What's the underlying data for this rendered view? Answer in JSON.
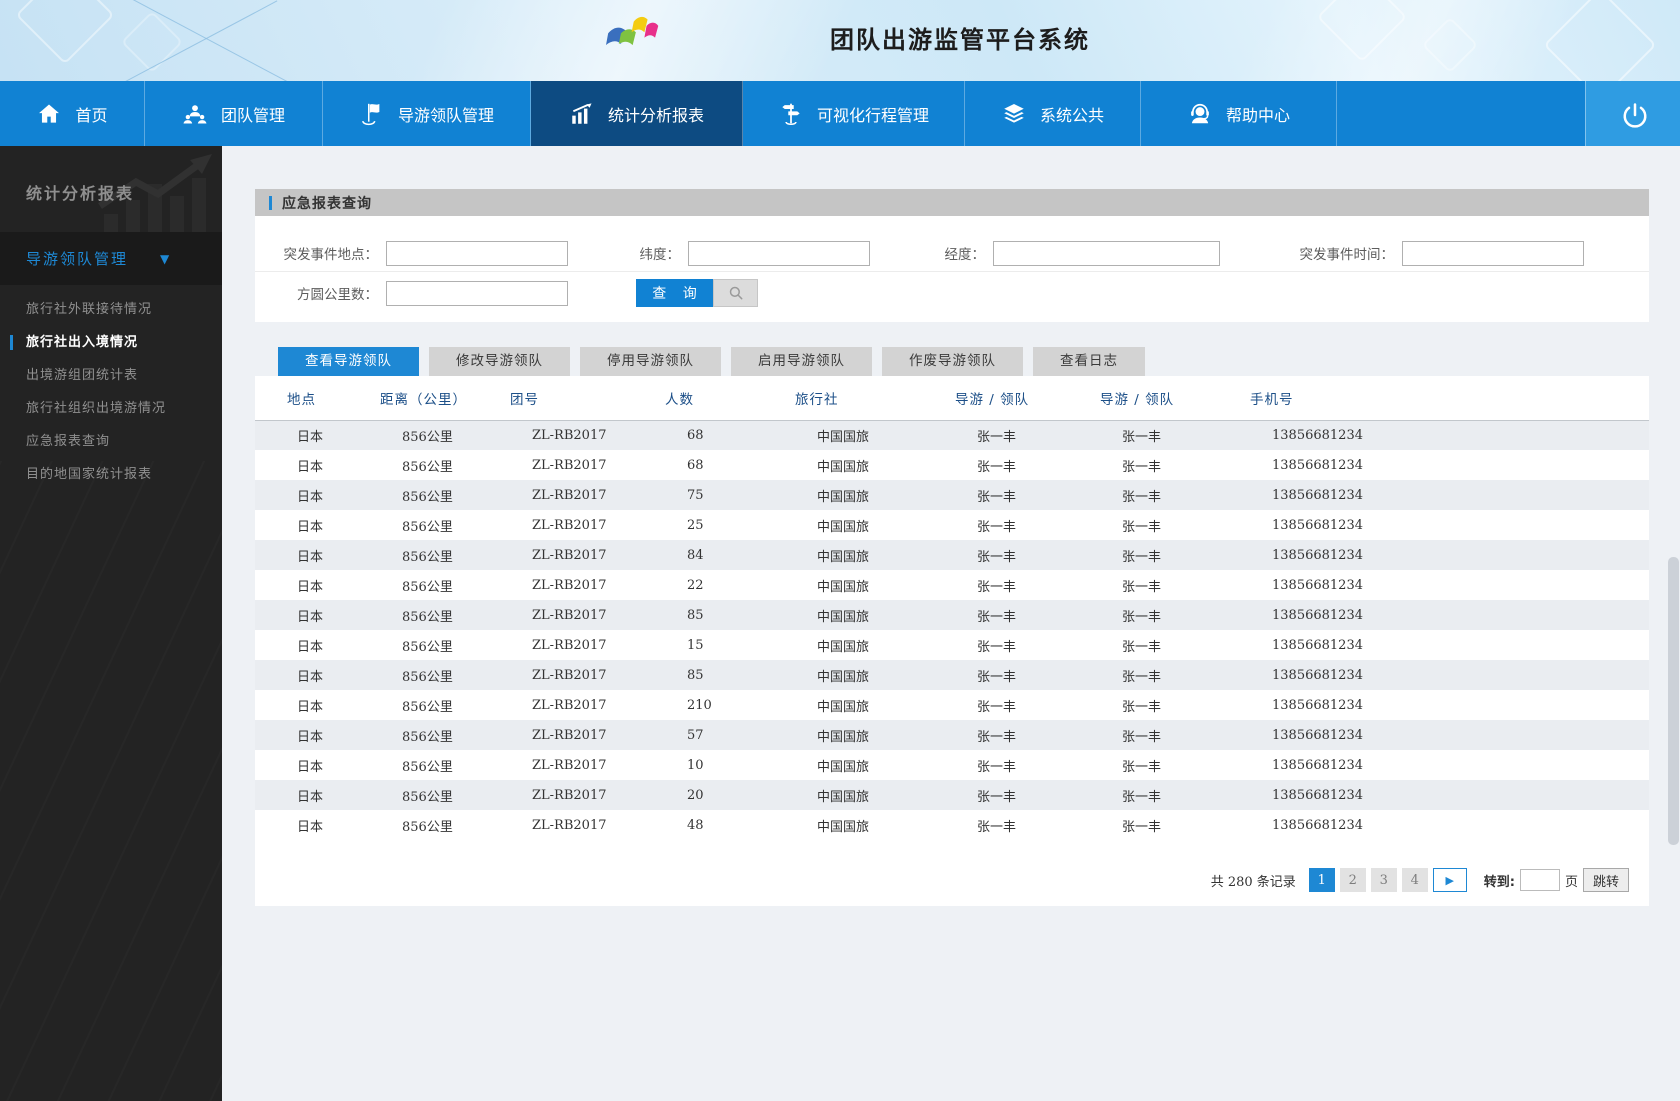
{
  "app": {
    "title": "团队出游监管平台系统",
    "logo": "brand-logo"
  },
  "nav": {
    "active_index": 3,
    "items": [
      {
        "label": "首页",
        "icon": "home-icon"
      },
      {
        "label": "团队管理",
        "icon": "team-icon"
      },
      {
        "label": "导游领队管理",
        "icon": "flag-icon"
      },
      {
        "label": "统计分析报表",
        "icon": "chart-icon"
      },
      {
        "label": "可视化行程管理",
        "icon": "signpost-icon"
      },
      {
        "label": "系统公共",
        "icon": "layers-icon"
      },
      {
        "label": "帮助中心",
        "icon": "headset-icon"
      }
    ],
    "logout_icon": "power-icon"
  },
  "sidebar": {
    "title": "统计分析报表",
    "watermark_icon": "chart-watermark-icon",
    "group": {
      "label": "导游领队管理",
      "icon": "chevron-down-icon",
      "expanded": true
    },
    "active_index": 1,
    "items": [
      "旅行社外联接待情况",
      "旅行社出入境情况",
      "出境游组团统计表",
      "旅行社组织出境游情况",
      "应急报表查询",
      "目的地国家统计报表"
    ]
  },
  "query_panel": {
    "title": "应急报表查询",
    "fields": [
      {
        "label": "突发事件地点：",
        "value": ""
      },
      {
        "label": "纬度：",
        "value": ""
      },
      {
        "label": "经度：",
        "value": ""
      },
      {
        "label": "突发事件时间：",
        "value": ""
      },
      {
        "label": "方圆公里数：",
        "value": ""
      }
    ],
    "search_button": "查 询",
    "search_icon": "search-icon"
  },
  "tabs": {
    "active_index": 0,
    "items": [
      "查看导游领队",
      "修改导游领队",
      "停用导游领队",
      "启用导游领队",
      "作废导游领队",
      "查看日志"
    ]
  },
  "table": {
    "columns": [
      "地点",
      "距离（公里）",
      "团号",
      "人数",
      "旅行社",
      "导游 / 领队",
      "导游 / 领队",
      "手机号"
    ],
    "rows": [
      [
        "日本",
        "856公里",
        "ZL-RB2017",
        "68",
        "中国国旅",
        "张一丰",
        "张一丰",
        "13856681234"
      ],
      [
        "日本",
        "856公里",
        "ZL-RB2017",
        "68",
        "中国国旅",
        "张一丰",
        "张一丰",
        "13856681234"
      ],
      [
        "日本",
        "856公里",
        "ZL-RB2017",
        "75",
        "中国国旅",
        "张一丰",
        "张一丰",
        "13856681234"
      ],
      [
        "日本",
        "856公里",
        "ZL-RB2017",
        "25",
        "中国国旅",
        "张一丰",
        "张一丰",
        "13856681234"
      ],
      [
        "日本",
        "856公里",
        "ZL-RB2017",
        "84",
        "中国国旅",
        "张一丰",
        "张一丰",
        "13856681234"
      ],
      [
        "日本",
        "856公里",
        "ZL-RB2017",
        "22",
        "中国国旅",
        "张一丰",
        "张一丰",
        "13856681234"
      ],
      [
        "日本",
        "856公里",
        "ZL-RB2017",
        "85",
        "中国国旅",
        "张一丰",
        "张一丰",
        "13856681234"
      ],
      [
        "日本",
        "856公里",
        "ZL-RB2017",
        "15",
        "中国国旅",
        "张一丰",
        "张一丰",
        "13856681234"
      ],
      [
        "日本",
        "856公里",
        "ZL-RB2017",
        "85",
        "中国国旅",
        "张一丰",
        "张一丰",
        "13856681234"
      ],
      [
        "日本",
        "856公里",
        "ZL-RB2017",
        "210",
        "中国国旅",
        "张一丰",
        "张一丰",
        "13856681234"
      ],
      [
        "日本",
        "856公里",
        "ZL-RB2017",
        "57",
        "中国国旅",
        "张一丰",
        "张一丰",
        "13856681234"
      ],
      [
        "日本",
        "856公里",
        "ZL-RB2017",
        "10",
        "中国国旅",
        "张一丰",
        "张一丰",
        "13856681234"
      ],
      [
        "日本",
        "856公里",
        "ZL-RB2017",
        "20",
        "中国国旅",
        "张一丰",
        "张一丰",
        "13856681234"
      ],
      [
        "日本",
        "856公里",
        "ZL-RB2017",
        "48",
        "中国国旅",
        "张一丰",
        "张一丰",
        "13856681234"
      ]
    ]
  },
  "pagination": {
    "total_label": "共 280 条记录",
    "total_records": "280",
    "pages": [
      "1",
      "2",
      "3",
      "4"
    ],
    "active_page": "1",
    "next_icon": "play-icon",
    "goto_label": "转到:",
    "goto_value": "",
    "page_unit": "页",
    "jump_label": "跳转"
  },
  "colors": {
    "accent": "#1e88d4",
    "nav_bg": "#1182d3",
    "nav_active_bg": "#0d4b82",
    "logout_bg": "#2f9ce2",
    "sidebar_bg": "#232323",
    "panel_title_bg": "#c5c5c5",
    "row_alt_bg": "#eaedf1",
    "table_header_text": "#1c4f88"
  }
}
